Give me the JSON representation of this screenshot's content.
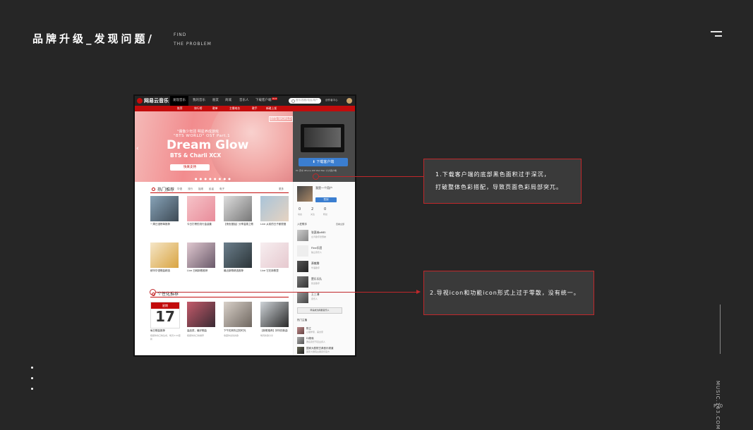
{
  "header": {
    "title": "品牌升级_发现问题/",
    "subtitle_line1": "FIND",
    "subtitle_line2": "THE PROBLEM"
  },
  "footer": {
    "vertical_site": "MUSIC.163.COM",
    "page_number": "P20"
  },
  "annotations": [
    {
      "line1": "1.下载客户端的底部黑色面积过于深沉，",
      "line2": "打破整体色彩搭配，导致页面色彩局部突兀。"
    },
    {
      "line1": "2.导视icon和功能icon形式上过于零散，没有统一。"
    }
  ],
  "screenshot": {
    "logo": "网易云音乐",
    "nav": [
      "发现音乐",
      "我的音乐",
      "朋友",
      "商城",
      "音乐人",
      "下载客户端"
    ],
    "nav_badge": "HOT",
    "search_placeholder": "音乐/视频/电台/用户",
    "creator": "创作者中心",
    "subnav": [
      "推荐",
      "排行榜",
      "歌单",
      "主播电台",
      "歌手",
      "新碟上架"
    ],
    "banner": {
      "line1": "\"偶像少年团 明星养成游戏",
      "line2": "\"BTS WORLD\" OST Part.1",
      "line3": "Dream Glow",
      "line4": "BTS & Charli XCX",
      "button": "快来支持",
      "tag": "BTS WORLD"
    },
    "download_button": "下载客户端",
    "download_note": "PC 安卓 iPhone WP iPad Mac 六大客户端",
    "hot": {
      "title": "热门推荐",
      "tabs": [
        "华语",
        "流行",
        "摇滚",
        "民谣",
        "电子"
      ],
      "more": "更多",
      "captions": [
        "一周日漫榜单推荐",
        "今日打榜的流行金曲集",
        "【夜色慢摇】分享温柔之歌",
        "Live 从前的日子都很慢",
        "耐听华语歌曲精选",
        "Live 日韩新歌推荐",
        "最近新歌精选推荐",
        "Live 它在新歌里"
      ]
    },
    "personal": {
      "title": "个性化推荐",
      "calendar_label": "星期",
      "calendar_day": "17",
      "captions": [
        "每日歌曲推荐",
        "高品质，最好歌曲",
        "下午的风吹过的时光",
        "【新歌推荐】好听的新曲"
      ],
      "sub": [
        "根据你的口味生成，每天6:00更新",
        "根据你的口味推荐",
        "收藏你喜欢的歌",
        "每周新歌分享"
      ]
    },
    "sidebar": {
      "user_name": "我是一个用户",
      "signin_button": "签到",
      "stats": [
        {
          "value": "0",
          "label": "动态"
        },
        {
          "value": "2",
          "label": "关注"
        },
        {
          "value": "0",
          "label": "粉丝"
        }
      ],
      "singers_title": "入驻歌手",
      "singers_more": "查看全部",
      "singers": [
        {
          "name": "张惠妹aMEI",
          "desc": "台湾歌手张惠妹"
        },
        {
          "name": "Fine乐团",
          "desc": "独立音乐人"
        },
        {
          "name": "萧敬腾",
          "desc": "华语歌手"
        },
        {
          "name": "赞乐乐队",
          "desc": "民谣歌手"
        },
        {
          "name": "王三溥",
          "desc": "音乐人"
        }
      ],
      "apply_button": "申请成为网易音乐人",
      "dj_title": "热门主播",
      "djs": [
        {
          "name": "陈立",
          "desc": "心理学家、美食家"
        },
        {
          "name": "DJ艳秋",
          "desc": "著名音乐节目主持人"
        },
        {
          "name": "国家大剧院古典音乐频道",
          "desc": "国家大剧院古典音乐官方"
        }
      ]
    }
  }
}
